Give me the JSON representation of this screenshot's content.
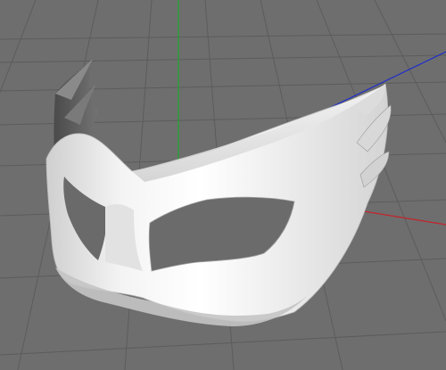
{
  "viewport": {
    "background": "#6e6e6e",
    "grid_color": "#5a5a5a",
    "axes": {
      "y_color": "#1faa2a",
      "z_color": "#1a2bd0",
      "x_color": "#c4242a"
    }
  },
  "object": {
    "kind": "mask-3d-model",
    "material_light": "#f2f2f2",
    "material_mid": "#d2d2d2",
    "material_dark": "#5e5e5e"
  }
}
